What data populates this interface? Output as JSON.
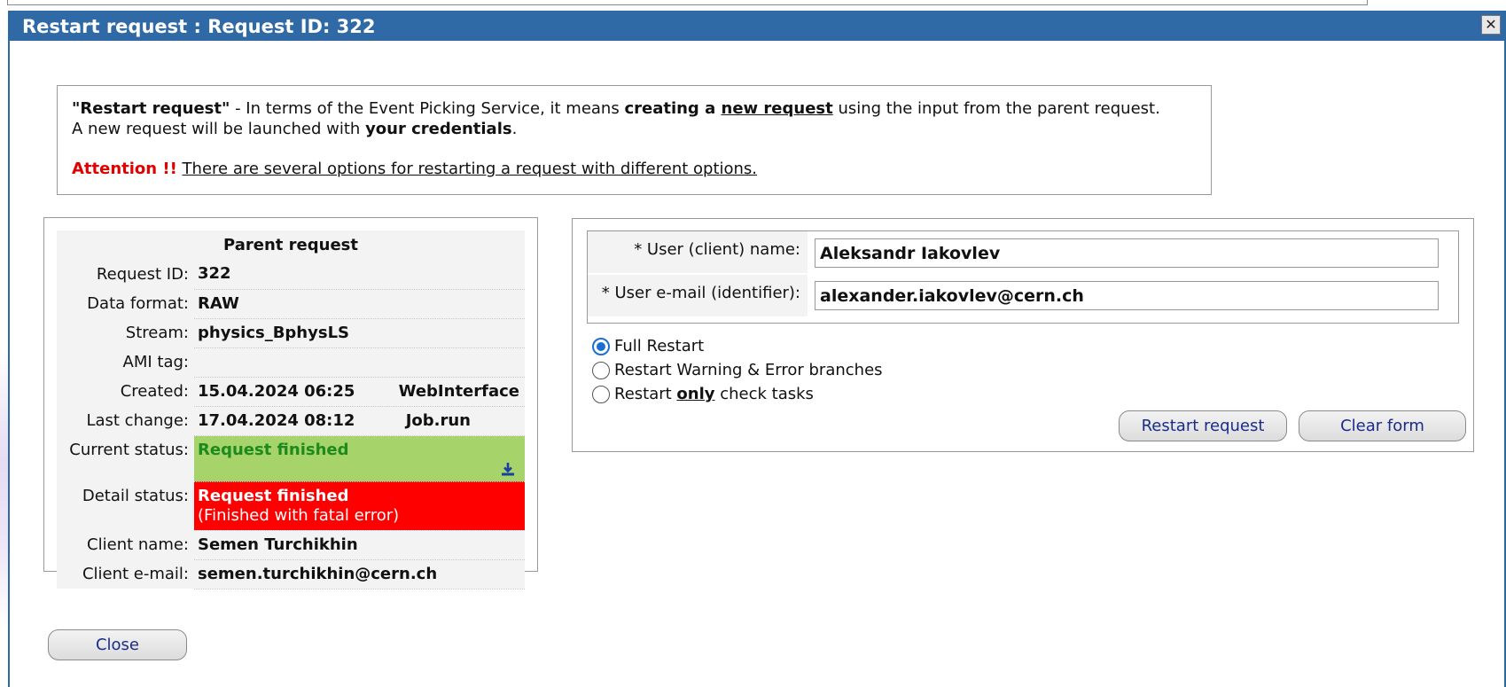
{
  "dialog": {
    "title": "Restart request : Request ID: 322",
    "close_glyph": "✕"
  },
  "info": {
    "line1_q": "\"Restart request\"",
    "line1_a": " - In terms of the Event Picking Service, it means ",
    "line1_b": "creating a ",
    "line1_c": "new request",
    "line1_d": " using the input from the parent request.",
    "line2_a": "A new request will be launched with ",
    "line2_b": "your credentials",
    "line2_c": ".",
    "attention": "Attention !!",
    "attention_text": "There are several options for restarting a request with different options."
  },
  "parent": {
    "header": "Parent request",
    "rows": {
      "request_id": {
        "label": "Request ID:",
        "value": "322"
      },
      "data_format": {
        "label": "Data format:",
        "value": "RAW"
      },
      "stream": {
        "label": "Stream:",
        "value": "physics_BphysLS"
      },
      "ami_tag": {
        "label": "AMI tag:",
        "value": ""
      },
      "created": {
        "label": "Created:",
        "value": "15.04.2024 06:25",
        "extra": "WebInterface"
      },
      "last_change": {
        "label": "Last change:",
        "value": "17.04.2024 08:12",
        "extra": "Job.run"
      },
      "current_status": {
        "label": "Current status:",
        "value": "Request finished"
      },
      "detail_status": {
        "label": "Detail status:",
        "value": "Request finished",
        "sub": "(Finished with fatal error)"
      },
      "client_name": {
        "label": "Client name:",
        "value": "Semen Turchikhin"
      },
      "client_email": {
        "label": "Client e-mail:",
        "value": "semen.turchikhin@cern.ch"
      }
    }
  },
  "form": {
    "user_name_label": "* User (client) name:",
    "user_name_value": "Aleksandr Iakovlev",
    "user_email_label": "* User e-mail (identifier):",
    "user_email_value": "alexander.iakovlev@cern.ch",
    "options": {
      "full": "Full Restart",
      "warn_err": "Restart Warning & Error branches",
      "only_a": "Restart ",
      "only_b": "only",
      "only_c": " check tasks"
    },
    "selected_option": "full",
    "restart_button": "Restart request",
    "clear_button": "Clear form"
  },
  "footer": {
    "close_button": "Close"
  },
  "colors": {
    "titlebar": "#2f6aa6",
    "status_green": "#a6d46a",
    "status_red": "#ff0000",
    "attention": "#e00000",
    "button_text": "#1a2c8a"
  },
  "icons": {
    "download": "download-icon"
  }
}
